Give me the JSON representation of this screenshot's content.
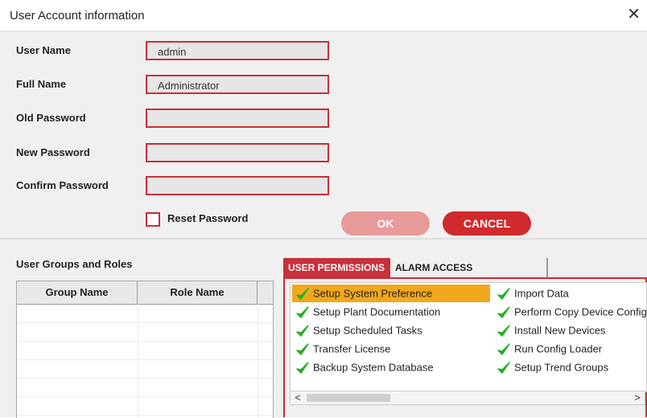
{
  "window": {
    "title": "User Account information",
    "close_label": "✕"
  },
  "form": {
    "user_name": {
      "label": "User Name",
      "value": "admin"
    },
    "full_name": {
      "label": "Full Name",
      "value": "Administrator"
    },
    "old_password": {
      "label": "Old Password",
      "value": ""
    },
    "new_password": {
      "label": "New Password",
      "value": ""
    },
    "confirm_password": {
      "label": "Confirm Password",
      "value": ""
    },
    "reset_password": {
      "label": "Reset Password",
      "checked": false
    }
  },
  "buttons": {
    "ok": "OK",
    "cancel": "CANCEL"
  },
  "groups": {
    "title": "User Groups and Roles",
    "columns": [
      "Group Name",
      "Role Name"
    ],
    "rows": []
  },
  "tabs": [
    "USER PERMISSIONS",
    "ALARM ACCESS PERMISSIONS"
  ],
  "permissions": [
    {
      "label": "Setup System Preference",
      "checked": true,
      "selected": true
    },
    {
      "label": "Import Data",
      "checked": true
    },
    {
      "label": "Setup Plant Documentation",
      "checked": true
    },
    {
      "label": "Perform Copy Device Config",
      "checked": true
    },
    {
      "label": "Setup Scheduled Tasks",
      "checked": true
    },
    {
      "label": "Install New Devices",
      "checked": true
    },
    {
      "label": "Transfer License",
      "checked": true
    },
    {
      "label": "Run Config Loader",
      "checked": true
    },
    {
      "label": "Backup System Database",
      "checked": true
    },
    {
      "label": "Setup Trend Groups",
      "checked": true
    }
  ],
  "scrollbar": {
    "left": "<",
    "right": ">"
  },
  "colors": {
    "accent": "#c8303a",
    "selected": "#f2a81d",
    "check": "#22b022"
  }
}
